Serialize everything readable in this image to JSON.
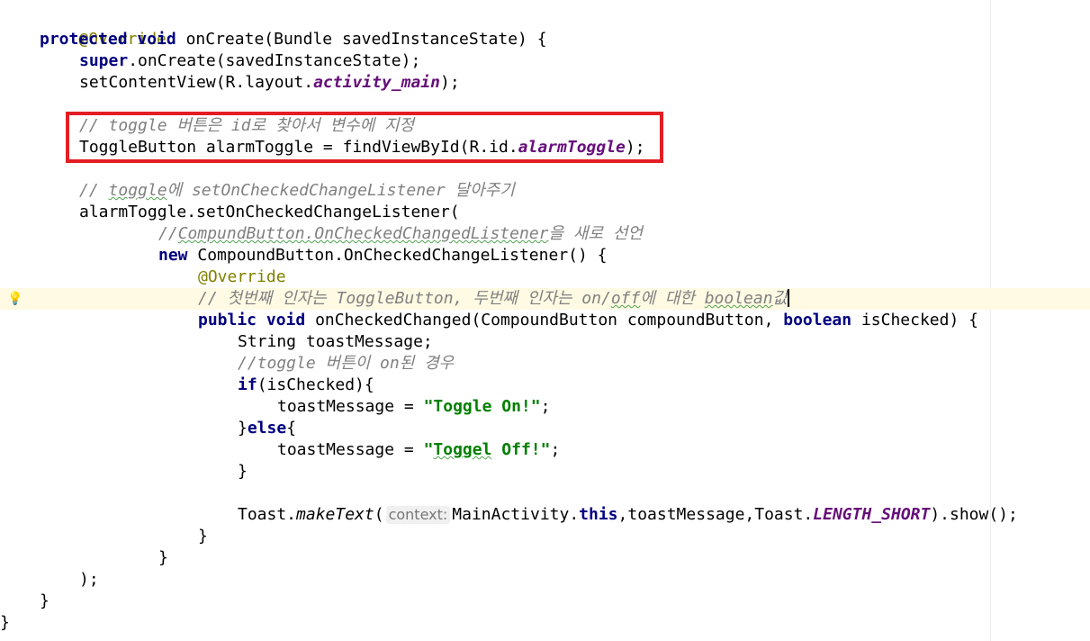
{
  "code": {
    "l1": {
      "annotation": "@Override"
    },
    "l2": {
      "kw1": "protected",
      "kw2": "void",
      "rest": " onCreate(Bundle savedInstanceState) {"
    },
    "l3": {
      "kw": "super",
      "rest": ".onCreate(savedInstanceState);"
    },
    "l4": {
      "pre": "setContentView(R.layout.",
      "field": "activity_main",
      "post": ");"
    },
    "l6": {
      "comment": "// toggle 버튼은 id로 찾아서 변수에 지정"
    },
    "l7": {
      "pre": "ToggleButton alarmToggle = findViewById(R.id.",
      "field": "alarmToggle",
      "post": ");"
    },
    "l9": {
      "comment_a": "// ",
      "comment_typo1": "toggle",
      "comment_b": "에 setOnCheckedChangeListener 달아주기"
    },
    "l10": {
      "text": "alarmToggle.setOnCheckedChangeListener("
    },
    "l11": {
      "comment_a": "//",
      "comment_typo": "CompundButton.OnCheckedChangedListener",
      "comment_b": "을 새로 선언"
    },
    "l12": {
      "kw": "new",
      "rest": " CompoundButton.OnCheckedChangeListener() {"
    },
    "l13": {
      "annotation": "@Override"
    },
    "l14": {
      "comment_a": "// 첫번째 인자는 ToggleButton, 두번째 인자는 on/",
      "comment_typo": "off",
      "comment_b": "에 대한 ",
      "comment_typo2": "boolean",
      "comment_c": "값"
    },
    "l15": {
      "kw1": "public",
      "kw2": "void",
      "mid": " onCheckedChanged(CompoundButton compoundButton, ",
      "kw3": "boolean",
      "post": " isChecked) {"
    },
    "l16": {
      "text": "String toastMessage;"
    },
    "l17": {
      "comment": "//toggle 버튼이 on된 경우"
    },
    "l18": {
      "kw": "if",
      "rest": "(isChecked){"
    },
    "l19": {
      "pre": "toastMessage = ",
      "str": "\"Toggle On!\"",
      "post": ";"
    },
    "l20": {
      "pre": "}",
      "kw": "else",
      "post": "{"
    },
    "l21": {
      "pre": "toastMessage = ",
      "str_a": "\"",
      "str_typo": "Toggel",
      "str_b": " Off!\"",
      "post": ";"
    },
    "l22": {
      "text": "}"
    },
    "l24": {
      "pre": "Toast.",
      "method": "makeText",
      "open": "(",
      "hint": "context:",
      "mid": "MainActivity.",
      "kw": "this",
      "mid2": ",toastMessage,Toast.",
      "field": "LENGTH_SHORT",
      "post": ").show();"
    },
    "l25": {
      "text": "}"
    },
    "l26": {
      "text": "}"
    },
    "l27": {
      "text": ");"
    },
    "l28": {
      "text": "}"
    },
    "l29": {
      "text": "}"
    }
  },
  "colors": {
    "keyword": "#000080",
    "annotation": "#808000",
    "comment": "#808080",
    "field": "#660e7a",
    "string": "#008000",
    "highlight_box": "#e31e24",
    "caret_row": "#fffae3"
  },
  "icons": {
    "gutter": "lightbulb-icon"
  }
}
